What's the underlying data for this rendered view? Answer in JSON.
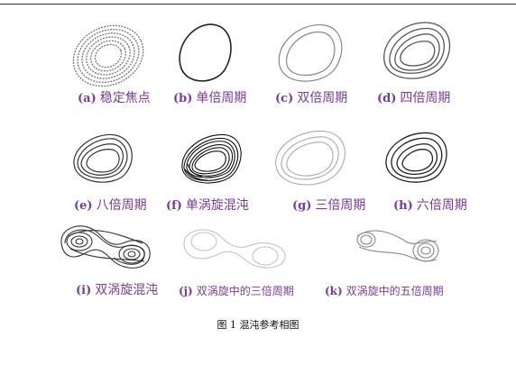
{
  "panels": [
    {
      "label": "(a)",
      "text": "稳定焦点"
    },
    {
      "label": "(b)",
      "text": "单倍周期"
    },
    {
      "label": "(c)",
      "text": "双倍周期"
    },
    {
      "label": "(d)",
      "text": "四倍周期"
    },
    {
      "label": "(e)",
      "text": "八倍周期"
    },
    {
      "label": "(f)",
      "text": "单涡旋混沌"
    },
    {
      "label": "(g)",
      "text": "三倍周期"
    },
    {
      "label": "(h)",
      "text": "六倍周期"
    },
    {
      "label": "(i)",
      "text": "双涡旋混沌"
    },
    {
      "label": "(j)",
      "text": "双涡旋中的三倍周期"
    },
    {
      "label": "(k)",
      "text": "双涡旋中的五倍周期"
    }
  ],
  "figure_caption": "图 1 混沌参考相图",
  "colors": {
    "caption_purple": "#7a3a9a",
    "stroke_dark": "#333333",
    "stroke_light": "#b8b8b8"
  }
}
